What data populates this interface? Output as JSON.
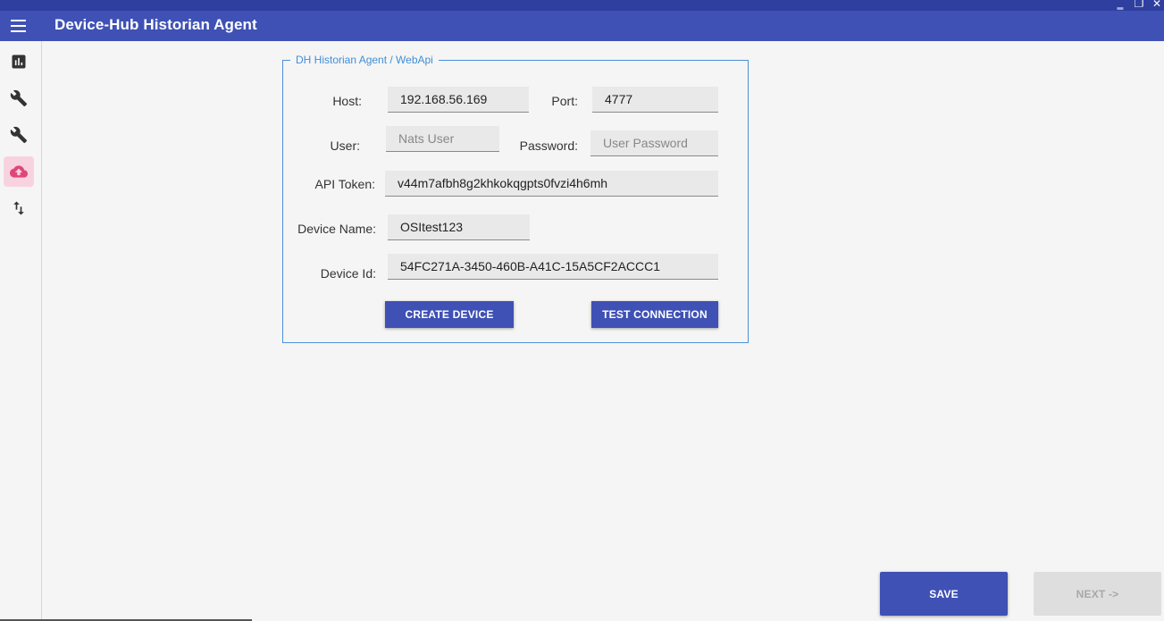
{
  "window": {
    "minimize_glyph": "‗",
    "restore_glyph": "❐",
    "close_glyph": "✕"
  },
  "appbar": {
    "title": "Device-Hub Historian Agent"
  },
  "sidebar": {
    "items": [
      {
        "icon": "bar-chart-icon",
        "active": false
      },
      {
        "icon": "wrench-icon",
        "active": false
      },
      {
        "icon": "wrench-icon",
        "active": false
      },
      {
        "icon": "cloud-upload-icon",
        "active": true
      },
      {
        "icon": "swap-vertical-icon",
        "active": false
      }
    ],
    "active_color": "#f8d3df",
    "active_icon_color": "#e0457a"
  },
  "form": {
    "group_title": "DH Historian Agent / WebApi",
    "host_label": "Host:",
    "host_value": "192.168.56.169",
    "port_label": "Port:",
    "port_value": "4777",
    "user_label": "User:",
    "user_placeholder": "Nats User",
    "password_label": "Password:",
    "password_placeholder": "User Password",
    "api_token_label": "API Token:",
    "api_token_value": "v44m7afbh8g2khkokqgpts0fvzi4h6mh",
    "device_name_label": "Device Name:",
    "device_name_value": "OSItest123",
    "device_id_label": "Device Id:",
    "device_id_value": "54FC271A-3450-460B-A41C-15A5CF2ACCC1",
    "create_device_label": "CREATE DEVICE",
    "test_connection_label": "TEST CONNECTION"
  },
  "footer": {
    "save_label": "SAVE",
    "next_label": "NEXT ->"
  },
  "colors": {
    "primary": "#3f51b5",
    "legend": "#3f8fd8",
    "disabled_bg": "#dedede"
  }
}
